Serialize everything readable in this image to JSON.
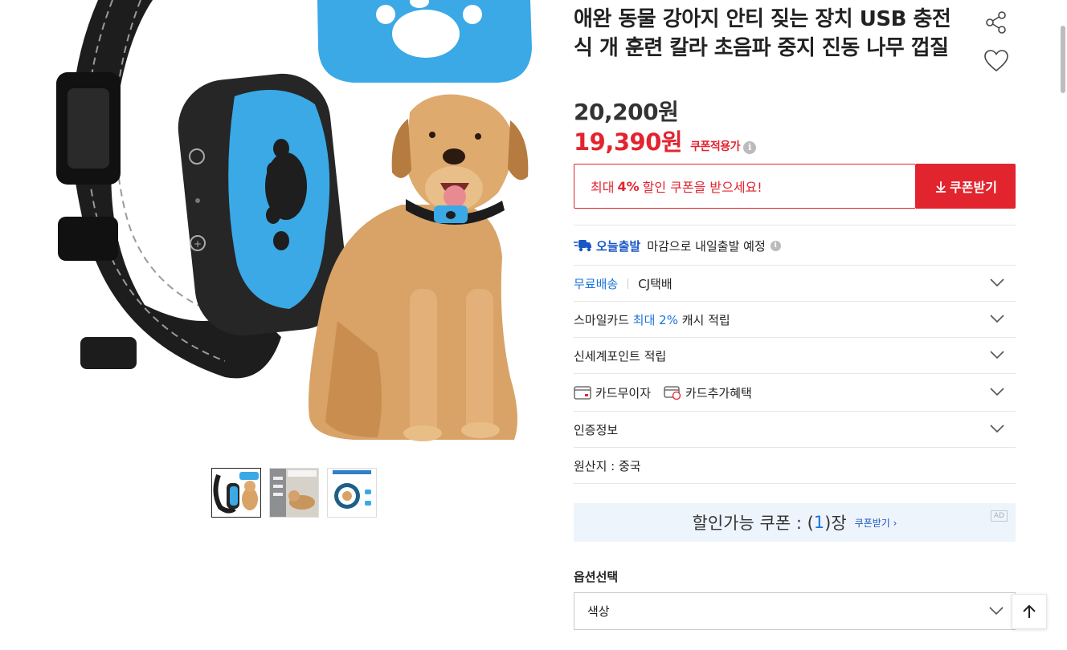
{
  "product": {
    "title": "애완 동물 강아지 안티 짖는 장치 USB 충전식 개 훈련 칼라 초음파 중지 진동 나무 껍질",
    "price_original": "20,200",
    "price_sale": "19,390",
    "currency": "원",
    "coupon_applied": "쿠폰적용가",
    "info_icon": "i"
  },
  "coupon_banner": {
    "prefix": "최대",
    "percent": "4%",
    "suffix": "할인 쿠폰을 받으세요!",
    "button_label": "쿠폰받기"
  },
  "delivery": {
    "today_label": "오늘출발",
    "today_text": "마감으로 내일출발 예정"
  },
  "rows": {
    "shipping_free": "무료배송",
    "shipping_carrier": "CJ택배",
    "smilecard_prefix": "스마일카드",
    "smilecard_highlight": "최대 2%",
    "smilecard_suffix": "캐시 적립",
    "shinsegae": "신세계포인트 적립",
    "card_interest_free": "카드무이자",
    "card_extra": "카드추가혜택",
    "certification": "인증정보",
    "origin": "원산지 : 중국"
  },
  "ad_coupon": {
    "prefix": "할인가능 쿠폰 : (",
    "count": "1",
    "suffix": ")장",
    "link": "쿠폰받기 ›",
    "ad_tag": "AD"
  },
  "options": {
    "label": "옵션선택",
    "select_value": "색상"
  },
  "colors": {
    "accent_red": "#e2242f",
    "link_blue": "#1a73d9",
    "collar_blue": "#3aa9e6"
  }
}
